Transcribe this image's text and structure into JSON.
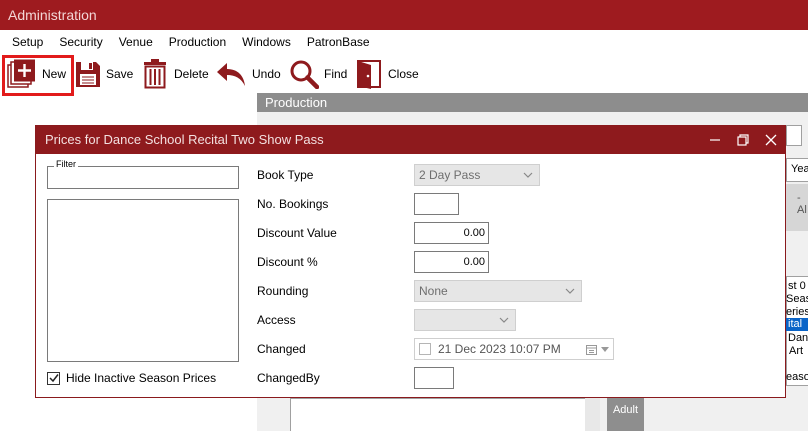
{
  "app": {
    "title": "Administration"
  },
  "menu": {
    "items": [
      "Setup",
      "Security",
      "Venue",
      "Production",
      "Windows",
      "PatronBase"
    ]
  },
  "toolbar": {
    "new_label": "New",
    "save_label": "Save",
    "delete_label": "Delete",
    "undo_label": "Undo",
    "find_label": "Find",
    "close_label": "Close"
  },
  "background": {
    "production_header": "Production",
    "fragments": [
      "Yea",
      "- Al",
      "st 0",
      "Seas",
      "eries",
      "ital",
      "Dan",
      "Art",
      "easo"
    ],
    "adult_label": "Adult"
  },
  "dialog": {
    "title": "Prices for Dance School Recital Two Show Pass",
    "filter_legend": "Filter",
    "filter_value": "",
    "hide_inactive_label": "Hide Inactive Season Prices",
    "hide_inactive_checked": true,
    "fields": {
      "book_type_label": "Book Type",
      "book_type_value": "2 Day Pass",
      "no_bookings_label": "No. Bookings",
      "no_bookings_value": "",
      "discount_value_label": "Discount Value",
      "discount_value_value": "0.00",
      "discount_pct_label": "Discount %",
      "discount_pct_value": "0.00",
      "rounding_label": "Rounding",
      "rounding_value": "None",
      "access_label": "Access",
      "access_value": "",
      "changed_label": "Changed",
      "changed_value": "21 Dec  2023 10:07 PM",
      "changedby_label": "ChangedBy",
      "changedby_value": ""
    }
  },
  "colors": {
    "brand": "#9e1b1f",
    "highlight": "#e21b1b"
  }
}
